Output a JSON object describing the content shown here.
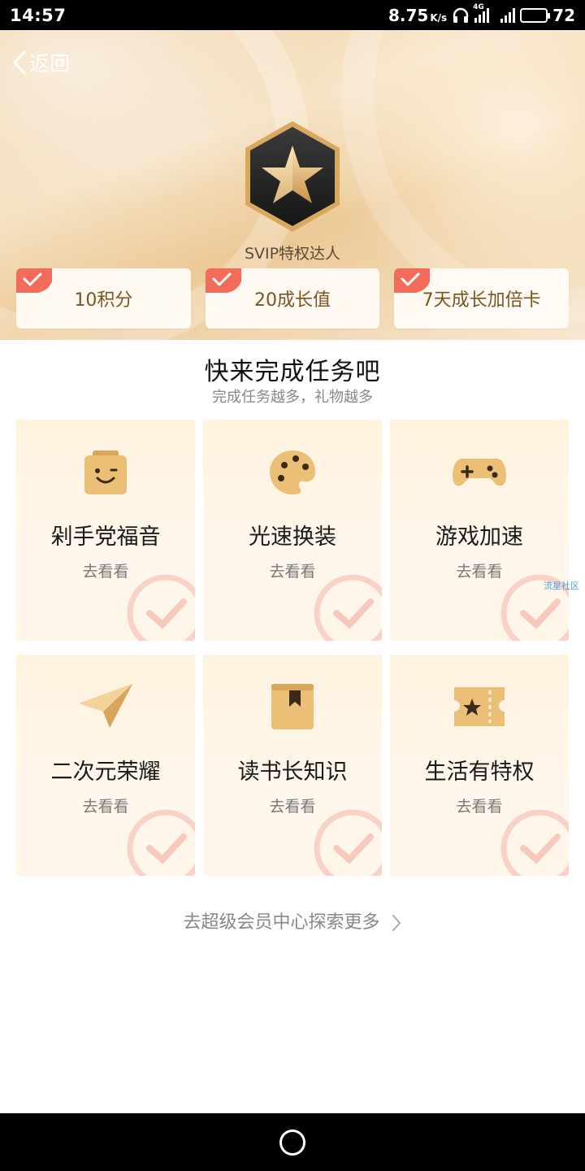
{
  "status_bar": {
    "time": "14:57",
    "net_speed": "8.75",
    "net_unit": "K/s",
    "network_type": "4G",
    "battery": "72",
    "battery_level_percent": 72,
    "icons": [
      "headset-icon",
      "signal-4g-icon",
      "signal-icon",
      "battery-icon"
    ]
  },
  "header": {
    "back_label": "返回",
    "badge_icon": "star-hexagon-badge-icon",
    "badge_title": "SVIP特权达人",
    "rewards": [
      {
        "label": "10积分",
        "checked": true
      },
      {
        "label": "20成长值",
        "checked": true
      },
      {
        "label": "7天成长加倍卡",
        "checked": true
      }
    ]
  },
  "tasks": {
    "title": "快来完成任务吧",
    "subtitle": "完成任务越多，礼物越多",
    "cards": [
      {
        "name": "剁手党福音",
        "action": "去看看",
        "icon": "shopping-bag-smile-icon"
      },
      {
        "name": "光速换装",
        "action": "去看看",
        "icon": "palette-icon"
      },
      {
        "name": "游戏加速",
        "action": "去看看",
        "icon": "gamepad-icon"
      },
      {
        "name": "二次元荣耀",
        "action": "去看看",
        "icon": "paper-plane-icon"
      },
      {
        "name": "读书长知识",
        "action": "去看看",
        "icon": "book-bookmark-icon"
      },
      {
        "name": "生活有特权",
        "action": "去看看",
        "icon": "ticket-star-icon"
      }
    ]
  },
  "watermark": "流星社区",
  "footer": {
    "more_label": "去超级会员中心探索更多"
  },
  "colors": {
    "gold": "#e3b36a",
    "check_red": "#f26b5b",
    "card_bg": "#fff4e2"
  }
}
